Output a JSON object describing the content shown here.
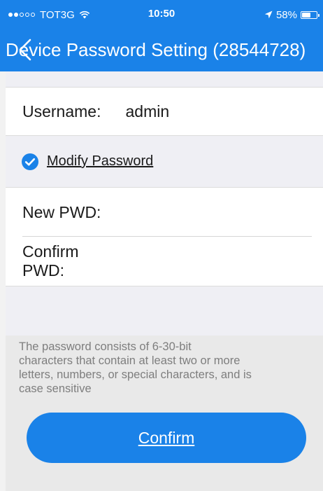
{
  "status_bar": {
    "signal_dots_filled": 2,
    "signal_dots_total": 5,
    "carrier": "TOT3G",
    "wifi_icon": "wifi-icon",
    "time": "10:50",
    "location_icon": "location-arrow-icon",
    "battery_percent_label": "58%",
    "battery_level": 0.58
  },
  "nav": {
    "title": "Device Password Setting (28544728)",
    "back_icon": "back-chevron-icon"
  },
  "form": {
    "username_label": "Username:",
    "username_value": "admin",
    "modify_checked": true,
    "modify_label": "Modify Password",
    "new_pwd_label": "New PWD:",
    "new_pwd_value": "",
    "confirm_pwd_label": "Confirm PWD:",
    "confirm_pwd_value": ""
  },
  "hint": "The password  consists of 6-30-bit\ncharacters that contain at least two or more\nletters, numbers, or special characters, and is\ncase sensitive",
  "confirm_button": "Confirm",
  "colors": {
    "accent": "#1a82e8",
    "background": "#efeff4",
    "hint_text": "#7e7e7e"
  }
}
